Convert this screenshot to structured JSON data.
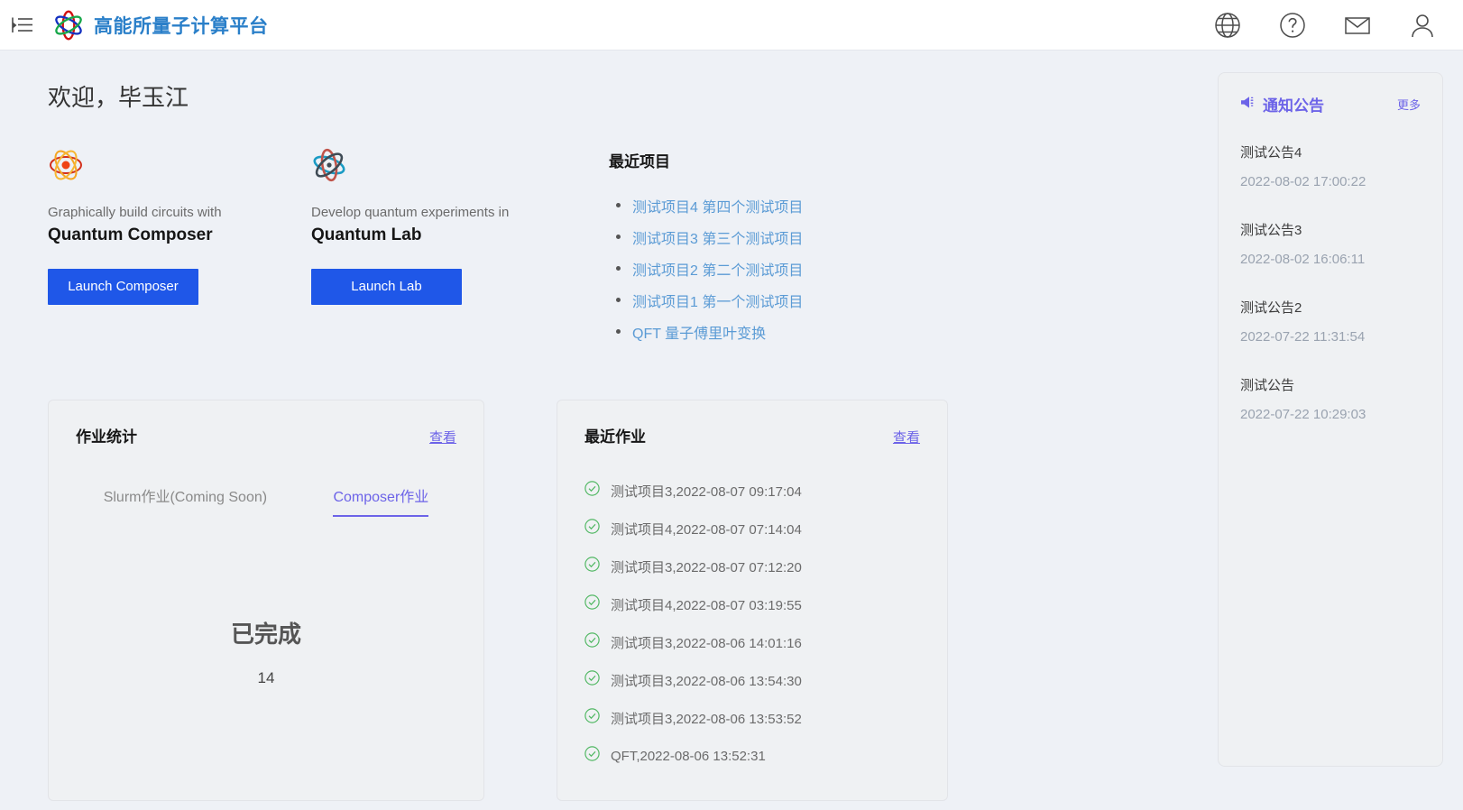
{
  "header": {
    "menu_icon": "hamburger-collapse-icon",
    "logo_icon": "atom-logo-icon",
    "title": "高能所量子计算平台",
    "icons": [
      {
        "name": "globe-icon",
        "label": "语言"
      },
      {
        "name": "help-icon",
        "label": "帮助"
      },
      {
        "name": "mail-icon",
        "label": "消息"
      },
      {
        "name": "user-icon",
        "label": "用户"
      }
    ]
  },
  "main": {
    "welcome": "欢迎，毕玉江",
    "launch_cards": [
      {
        "icon": "atom-orange-icon",
        "subtitle": "Graphically build circuits with",
        "name": "Quantum Composer",
        "button": "Launch Composer"
      },
      {
        "icon": "atom-blue-icon",
        "subtitle": "Develop quantum experiments in",
        "name": "Quantum Lab",
        "button": "Launch Lab"
      }
    ],
    "recent_projects": {
      "title": "最近项目",
      "items": [
        "测试项目4 第四个测试项目",
        "测试项目3 第三个测试项目",
        "测试项目2 第二个测试项目",
        "测试项目1 第一个测试项目",
        "QFT 量子傅里叶变换"
      ]
    },
    "job_stats": {
      "title": "作业统计",
      "link": "查看",
      "tabs": [
        {
          "label": "Slurm作业(Coming Soon)",
          "active": false
        },
        {
          "label": "Composer作业",
          "active": true
        }
      ],
      "stat_label": "已完成",
      "stat_value": "14"
    },
    "recent_jobs": {
      "title": "最近作业",
      "link": "查看",
      "items": [
        {
          "status_icon": "check-circle-icon",
          "text": "测试项目3,2022-08-07 09:17:04"
        },
        {
          "status_icon": "check-circle-icon",
          "text": "测试项目4,2022-08-07 07:14:04"
        },
        {
          "status_icon": "check-circle-icon",
          "text": "测试项目3,2022-08-07 07:12:20"
        },
        {
          "status_icon": "check-circle-icon",
          "text": "测试项目4,2022-08-07 03:19:55"
        },
        {
          "status_icon": "check-circle-icon",
          "text": "测试项目3,2022-08-06 14:01:16"
        },
        {
          "status_icon": "check-circle-icon",
          "text": "测试项目3,2022-08-06 13:54:30"
        },
        {
          "status_icon": "check-circle-icon",
          "text": "测试项目3,2022-08-06 13:53:52"
        },
        {
          "status_icon": "check-circle-icon",
          "text": "QFT,2022-08-06 13:52:31"
        }
      ]
    }
  },
  "notices": {
    "icon": "megaphone-icon",
    "title": "通知公告",
    "more": "更多",
    "items": [
      {
        "name": "测试公告4",
        "time": "2022-08-02 17:00:22"
      },
      {
        "name": "测试公告3",
        "time": "2022-08-02 16:06:11"
      },
      {
        "name": "测试公告2",
        "time": "2022-07-22 11:31:54"
      },
      {
        "name": "测试公告",
        "time": "2022-07-22 10:29:03"
      }
    ]
  },
  "colors": {
    "brand_blue": "#2a7fc9",
    "accent_purple": "#6c63e8",
    "button_blue": "#1f57e8",
    "link_blue": "#5b9bd5",
    "success_green": "#52b864",
    "page_bg": "#eef1f6",
    "card_bg": "#eff1f3"
  }
}
